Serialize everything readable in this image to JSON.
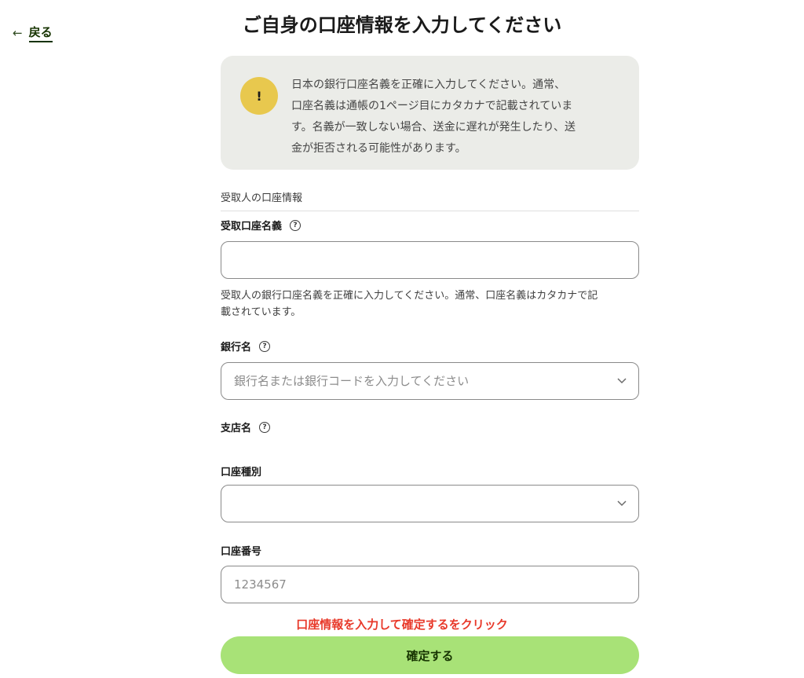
{
  "nav": {
    "back_label": "戻る"
  },
  "page": {
    "title": "ご自身の口座情報を入力してください"
  },
  "notice": {
    "icon_glyph": "!",
    "lines": [
      "日本の銀行口座名義を正確に入力してください。通常、",
      "口座名義は通帳の1ページ目にカタカナで記載されていま",
      "す。名義が一致しない場合、送金に遅れが発生したり、送",
      "金が拒否される可能性があります。"
    ]
  },
  "section": {
    "heading": "受取人の口座情報"
  },
  "fields": {
    "account_holder": {
      "label": "受取口座名義",
      "value": "",
      "help_lines": [
        "受取人の銀行口座名義を正確に入力してください。通常、口座名義はカタカナで記",
        "載されています。"
      ]
    },
    "bank_name": {
      "label": "銀行名",
      "placeholder": "銀行名または銀行コードを入力してください"
    },
    "branch_name": {
      "label": "支店名"
    },
    "account_type": {
      "label": "口座種別",
      "value": ""
    },
    "account_number": {
      "label": "口座番号",
      "placeholder": "1234567"
    }
  },
  "help_icon_glyph": "?",
  "instruction": "口座情報を入力して確定するをクリック",
  "submit": {
    "label": "確定する"
  },
  "colors": {
    "accent_green": "#a8e277",
    "dark_green": "#163300",
    "notice_bg": "#ebece8",
    "warning_yellow": "#e8c84e",
    "instruction_red": "#e8392a"
  }
}
